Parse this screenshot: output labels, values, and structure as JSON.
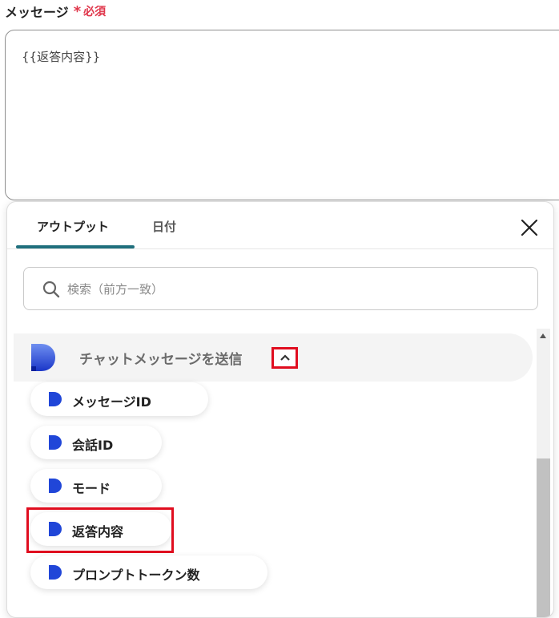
{
  "field": {
    "label": "メッセージ",
    "required_mark": "*",
    "required_text": "必須",
    "value": "{{返答内容}}"
  },
  "panel": {
    "tabs": [
      {
        "label": "アウトプット",
        "active": true
      },
      {
        "label": "日付",
        "active": false
      }
    ],
    "close_icon": "close-icon",
    "search": {
      "placeholder": "検索（前方一致）",
      "value": ""
    },
    "group": {
      "title": "チャットメッセージを送信",
      "collapse_icon": "chevron-up-icon",
      "items": [
        {
          "label": "メッセージID"
        },
        {
          "label": "会話ID"
        },
        {
          "label": "モード"
        },
        {
          "label": "返答内容",
          "highlighted": true
        },
        {
          "label": "プロンプトトークン数"
        }
      ]
    }
  },
  "colors": {
    "required": "#e0364b",
    "tab_underline": "#1f6f7d",
    "highlight": "#e00d1f",
    "logo_blue": "#2046d8"
  }
}
